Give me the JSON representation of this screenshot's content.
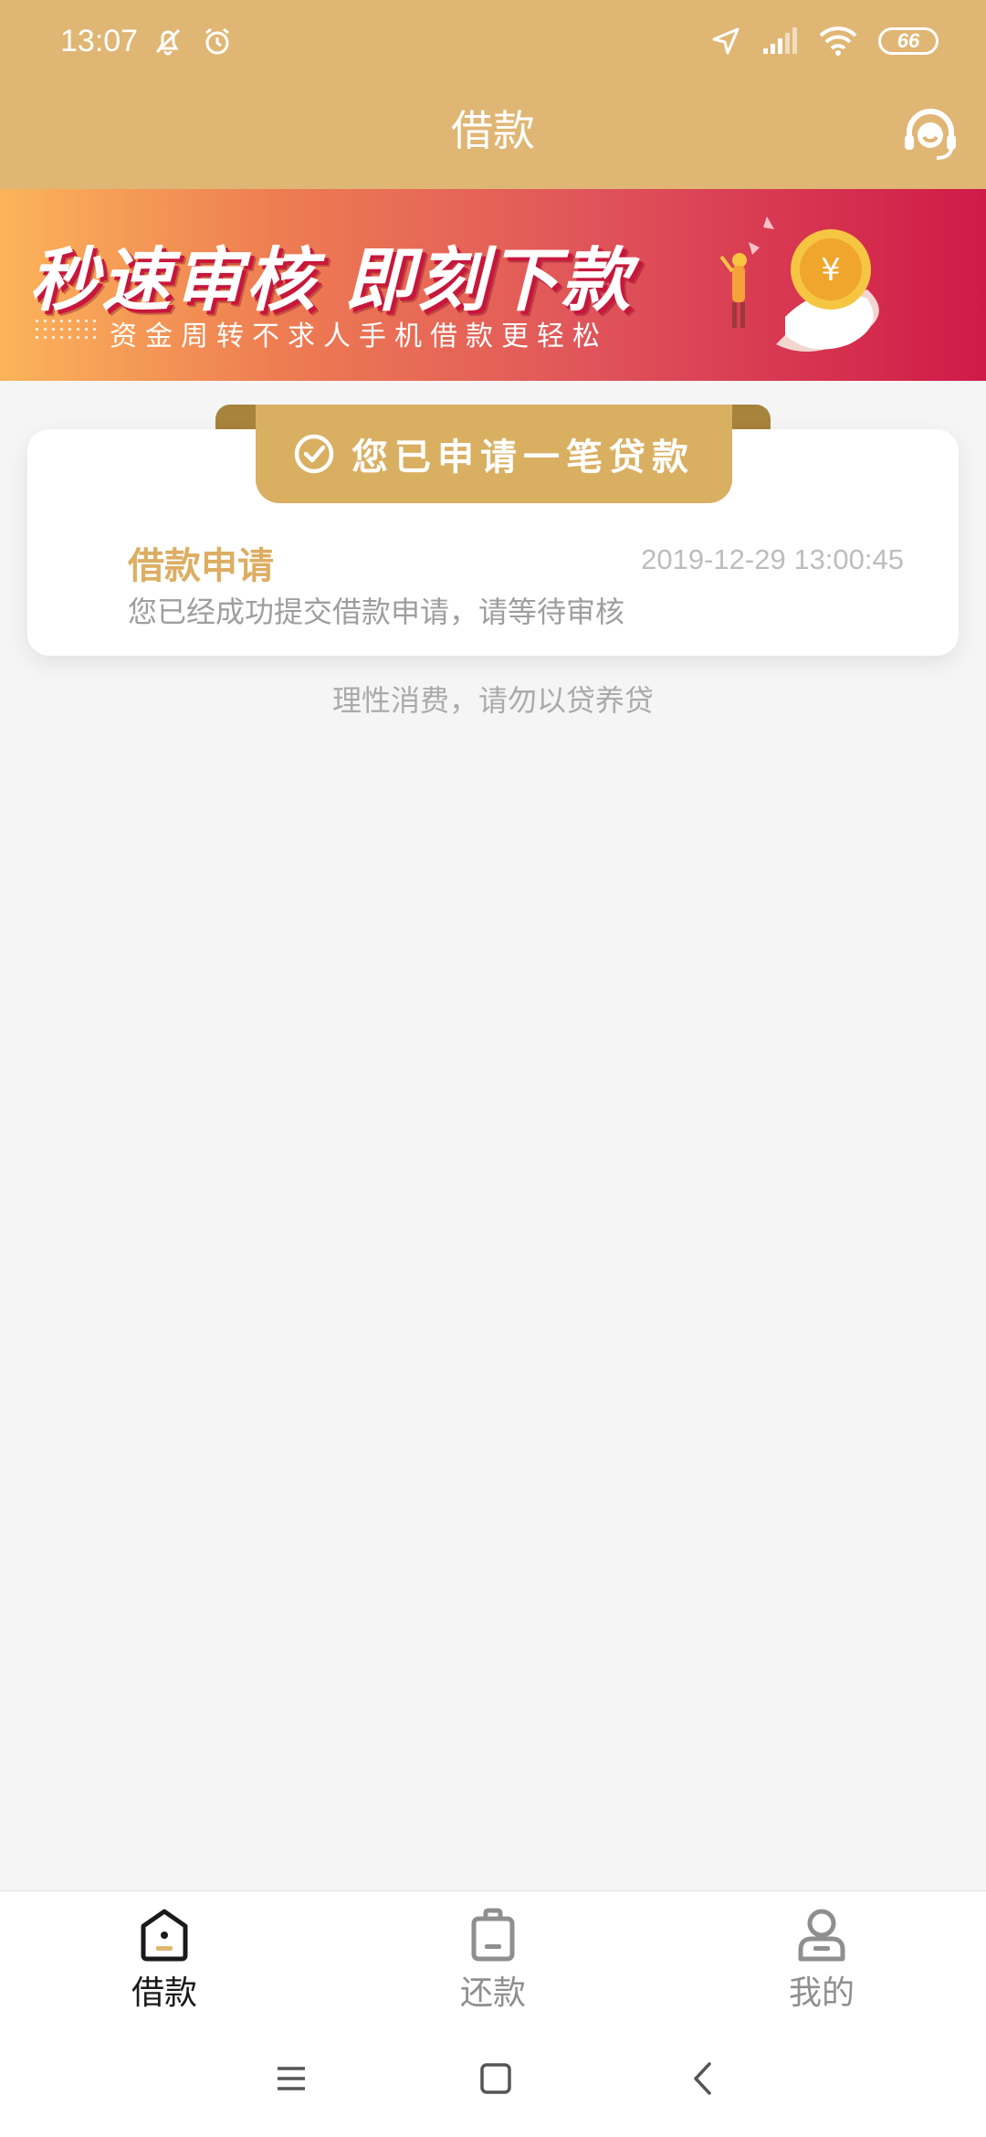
{
  "status_bar": {
    "time": "13:07",
    "battery": "66",
    "icons": [
      "bell-off-icon",
      "alarm-icon",
      "location-icon",
      "signal-icon",
      "wifi-icon",
      "battery-icon"
    ]
  },
  "header": {
    "title": "借款",
    "support_icon": "headset-icon",
    "background_color": "#e0b674"
  },
  "banner": {
    "headline": "秒速审核  即刻下款",
    "subline": "资金周转不求人手机借款更轻松"
  },
  "application": {
    "badge_label": "您已申请一笔贷款",
    "title": "借款申请",
    "datetime": "2019-12-29 13:00:45",
    "description": "您已经成功提交借款申请，请等待审核",
    "accent_color": "#dcae63"
  },
  "notice": "理性消费，请勿以贷养贷",
  "tabs": [
    {
      "label": "借款",
      "icon": "loan-icon",
      "active": true
    },
    {
      "label": "还款",
      "icon": "repay-icon",
      "active": false
    },
    {
      "label": "我的",
      "icon": "profile-icon",
      "active": false
    }
  ],
  "system_nav": [
    "menu-icon",
    "home-icon",
    "back-icon"
  ]
}
